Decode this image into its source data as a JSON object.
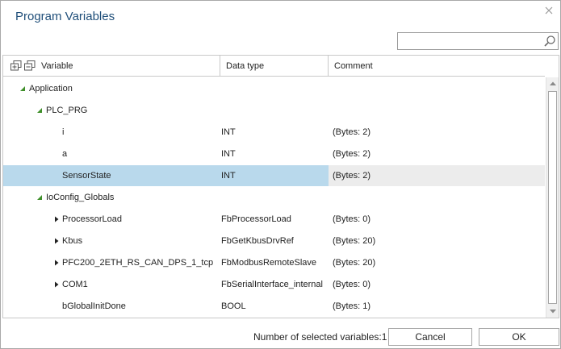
{
  "dialog": {
    "title": "Program Variables",
    "close_icon": "close-icon"
  },
  "search": {
    "value": "",
    "placeholder": "",
    "icon": "search-icon"
  },
  "grid": {
    "header_icons": [
      "expand-all-icon",
      "collapse-all-icon"
    ],
    "columns": [
      "Variable",
      "Data type",
      "Comment"
    ],
    "rows": [
      {
        "name": "Application",
        "type": "",
        "comment": "",
        "expander": "expanded"
      },
      {
        "name": "PLC_PRG",
        "type": "",
        "comment": "",
        "expander": "expanded"
      },
      {
        "name": "i",
        "type": "INT",
        "comment": "(Bytes: 2)",
        "expander": "none"
      },
      {
        "name": "a",
        "type": "INT",
        "comment": "(Bytes: 2)",
        "expander": "none"
      },
      {
        "name": "SensorState",
        "type": "INT",
        "comment": "(Bytes: 2)",
        "expander": "none",
        "selected": true
      },
      {
        "name": "IoConfig_Globals",
        "type": "",
        "comment": "",
        "expander": "expanded"
      },
      {
        "name": "ProcessorLoad",
        "type": "FbProcessorLoad",
        "comment": "(Bytes: 0)",
        "expander": "collapsed"
      },
      {
        "name": "Kbus",
        "type": "FbGetKbusDrvRef",
        "comment": "(Bytes: 20)",
        "expander": "collapsed"
      },
      {
        "name": "PFC200_2ETH_RS_CAN_DPS_1_tcp",
        "type": "FbModbusRemoteSlave",
        "comment": "(Bytes: 20)",
        "expander": "collapsed"
      },
      {
        "name": "COM1",
        "type": "FbSerialInterface_internal",
        "comment": "(Bytes: 0)",
        "expander": "collapsed"
      },
      {
        "name": "bGlobalInitDone",
        "type": "BOOL",
        "comment": "(Bytes: 1)",
        "expander": "none"
      }
    ]
  },
  "footer": {
    "selected_label": "Number of selected variables:",
    "selected_count": "1",
    "cancel_label": "Cancel",
    "ok_label": "OK"
  },
  "colors": {
    "title": "#1f4e79",
    "selection": "#b9d9ec",
    "comment_selection": "#ececec",
    "expander_expanded": "#3f8f2a",
    "expander_collapsed": "#222222"
  }
}
